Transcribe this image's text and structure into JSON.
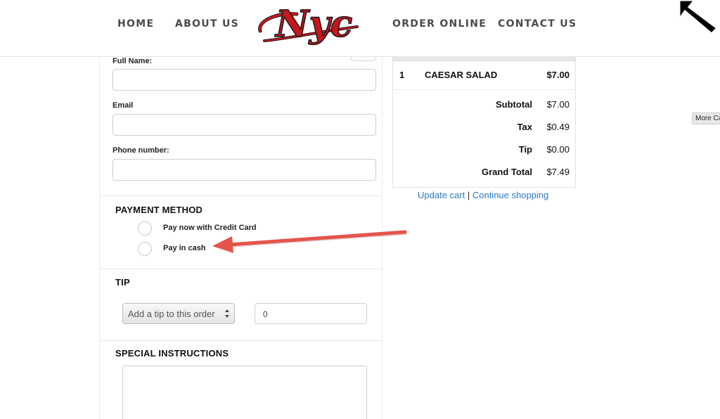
{
  "nav": {
    "home": "HOME",
    "about": "ABOUT US",
    "order": "ORDER ONLINE",
    "contact": "CONTACT US",
    "logo_text": "Nyc"
  },
  "form": {
    "full_name_label": "Full Name:",
    "email_label": "Email",
    "phone_label": "Phone number:"
  },
  "payment": {
    "title": "PAYMENT METHOD",
    "options": [
      "Pay now with Credit Card",
      "Pay in cash"
    ]
  },
  "tip": {
    "title": "TIP",
    "select_value": "Add a tip to this order",
    "amount_value": "0"
  },
  "special": {
    "title": "SPECIAL INSTRUCTIONS"
  },
  "cart": {
    "item": {
      "qty": "1",
      "name": "CAESAR SALAD",
      "price": "$7.00"
    },
    "totals": [
      {
        "label": "Subtotal",
        "value": "$7.00"
      },
      {
        "label": "Tax",
        "value": "$0.49"
      },
      {
        "label": "Tip",
        "value": "$0.00"
      },
      {
        "label": "Grand Total",
        "value": "$7.49"
      }
    ],
    "update_link": "Update cart",
    "separator": "|",
    "continue_link": "Continue shopping"
  },
  "tooltip": "More Ca",
  "colors": {
    "logo_red": "#c8161d",
    "link_blue": "#2a7bc0",
    "annotation_arrow": "#e5544b"
  }
}
